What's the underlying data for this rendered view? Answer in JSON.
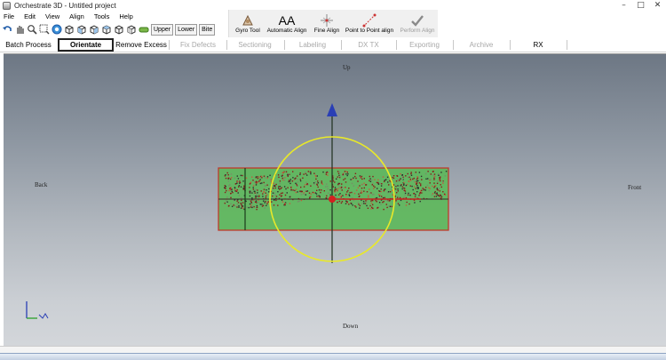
{
  "window": {
    "title": "Orchestrate 3D - Untitled project",
    "controls": [
      "–",
      "□",
      "✕"
    ]
  },
  "menu": [
    "File",
    "Edit",
    "View",
    "Align",
    "Tools",
    "Help"
  ],
  "toolbar": {
    "icons": [
      "undo-icon",
      "pan-icon",
      "zoom-icon",
      "zoom-box-icon",
      "rotate-view-icon",
      "cube-view-1-icon",
      "cube-view-2-icon",
      "cube-view-3-icon",
      "cube-view-4-icon",
      "cube-view-5-icon",
      "cube-view-6-icon",
      "jaw-icon"
    ],
    "jaw_buttons": [
      "Upper",
      "Lower",
      "Bite"
    ]
  },
  "align_tools": [
    {
      "label": "Gyro Tool",
      "icon": "gyro-icon",
      "enabled": true
    },
    {
      "label": "Automatic Align",
      "icon": "aa-icon",
      "enabled": true
    },
    {
      "label": "Fine Align",
      "icon": "fine-align-icon",
      "enabled": true
    },
    {
      "label": "Point to Point align",
      "icon": "point-align-icon",
      "enabled": true
    },
    {
      "label": "Perform Align",
      "icon": "checkmark-icon",
      "enabled": false
    }
  ],
  "workflow_tabs": [
    {
      "label": "Batch Process",
      "state": "normal"
    },
    {
      "label": "Orientate",
      "state": "active"
    },
    {
      "label": "Remove Excess",
      "state": "normal"
    },
    {
      "label": "Fix Defects",
      "state": "disabled"
    },
    {
      "label": "Sectioning",
      "state": "disabled"
    },
    {
      "label": "Labeling",
      "state": "disabled"
    },
    {
      "label": "DX TX",
      "state": "disabled"
    },
    {
      "label": "Exporting",
      "state": "disabled"
    },
    {
      "label": "Archive",
      "state": "disabled"
    },
    {
      "label": "RX",
      "state": "normal"
    }
  ],
  "viewport": {
    "labels": {
      "up": "Up",
      "down": "Down",
      "back": "Back",
      "front": "Front"
    },
    "colors": {
      "box": "#5cb85a",
      "box_border": "#c0392b",
      "circle": "#e8e82a",
      "axis_arrow": "#2a3fb5",
      "center": "#d42020"
    }
  }
}
